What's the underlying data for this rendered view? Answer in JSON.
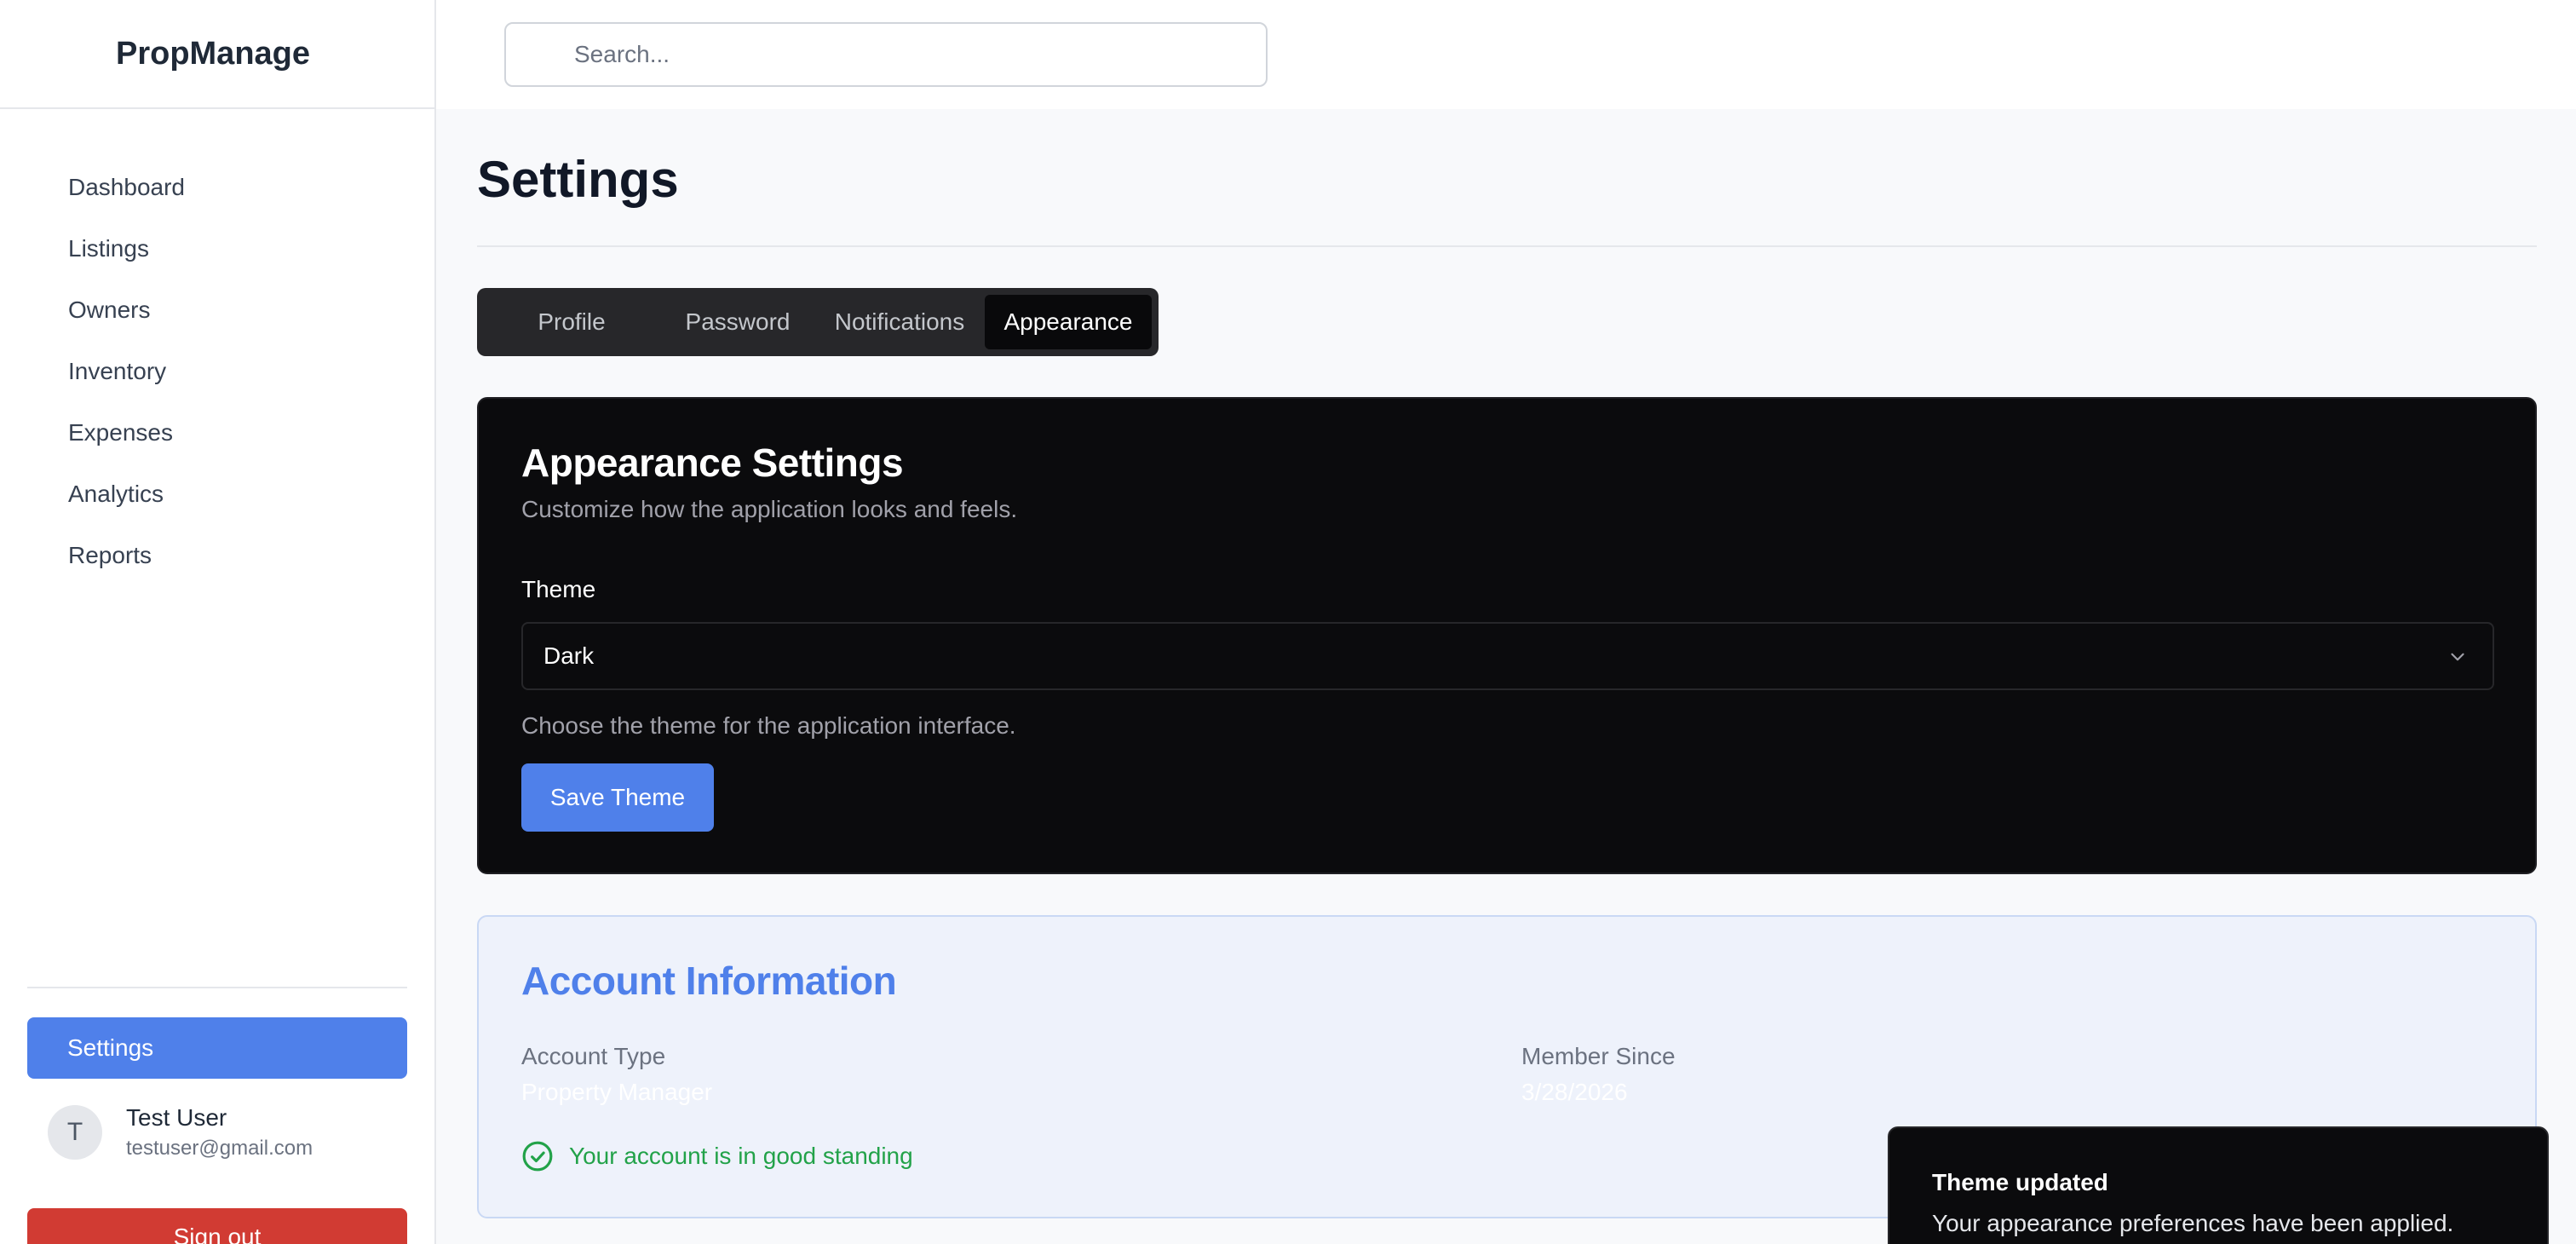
{
  "app": {
    "brand": "PropManage"
  },
  "sidebar": {
    "items": [
      {
        "label": "Dashboard"
      },
      {
        "label": "Listings"
      },
      {
        "label": "Owners"
      },
      {
        "label": "Inventory"
      },
      {
        "label": "Expenses"
      },
      {
        "label": "Analytics"
      },
      {
        "label": "Reports"
      }
    ],
    "settings_label": "Settings",
    "user": {
      "initial": "T",
      "name": "Test User",
      "email": "testuser@gmail.com"
    },
    "signout_label": "Sign out"
  },
  "search": {
    "placeholder": "Search...",
    "value": ""
  },
  "page": {
    "title": "Settings"
  },
  "tabs": [
    {
      "label": "Profile"
    },
    {
      "label": "Password"
    },
    {
      "label": "Notifications"
    },
    {
      "label": "Appearance",
      "active": true
    }
  ],
  "appearance": {
    "title": "Appearance Settings",
    "subtitle": "Customize how the application looks and feels.",
    "theme_label": "Theme",
    "theme_value": "Dark",
    "theme_help": "Choose the theme for the application interface.",
    "save_label": "Save Theme"
  },
  "account": {
    "title": "Account Information",
    "type_label": "Account Type",
    "type_value": "Property Manager",
    "since_label": "Member Since",
    "since_value": "3/28/2026",
    "standing": "Your account is in good standing"
  },
  "toast": {
    "title": "Theme updated",
    "message": "Your appearance preferences have been applied."
  },
  "colors": {
    "accent": "#4f80ea",
    "danger": "#d13b33",
    "success": "#22a249",
    "dark_card": "#0b0b0d"
  },
  "icons": {
    "select_chevron": "chevron-down-icon",
    "standing": "check-circle-icon"
  }
}
